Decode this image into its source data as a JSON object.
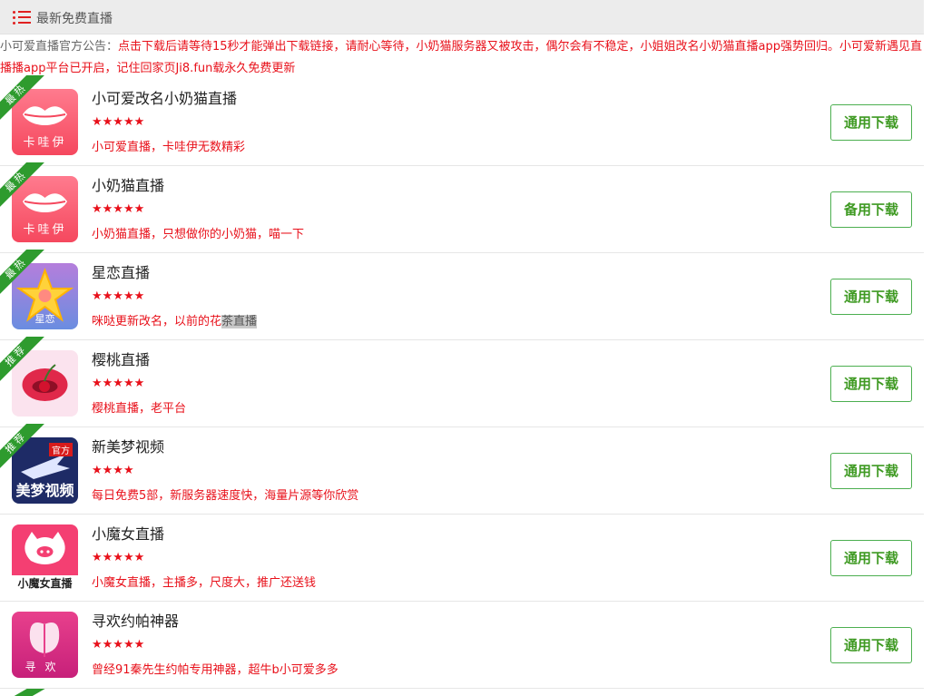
{
  "header": {
    "title": "最新免费直播",
    "icon": "list-icon"
  },
  "notice": {
    "prefix": "小可爱直播官方公告：",
    "text": "点击下载后请等待15秒才能弹出下载链接，请耐心等待，小奶猫服务器又被攻击，偶尔会有不稳定，小姐姐改名小奶猫直播app强势回归。小可爱新遇见直播播app平台已开启，记住回家页Ji8.fun载永久免费更新"
  },
  "items": [
    {
      "name": "小可爱改名小奶猫直播",
      "stars": "★★★★★",
      "desc": "小可爱直播，卡哇伊无数精彩",
      "button": "通用下载",
      "ribbon": "最热",
      "icon": "lips-icon",
      "icon_caption": "卡哇伊"
    },
    {
      "name": "小奶猫直播",
      "stars": "★★★★★",
      "desc": "小奶猫直播，只想做你的小奶猫，喵一下",
      "button": "备用下载",
      "ribbon": "最热",
      "icon": "lips-icon",
      "icon_caption": "卡哇伊"
    },
    {
      "name": "星恋直播",
      "stars": "★★★★★",
      "desc_a": "咪哒更新改名，以前的花",
      "desc_b": "茶直播",
      "button": "通用下载",
      "ribbon": "最热",
      "icon": "star-icon",
      "icon_caption": "星恋"
    },
    {
      "name": "樱桃直播",
      "stars": "★★★★★",
      "desc": "樱桃直播，老平台",
      "button": "通用下载",
      "ribbon": "推荐",
      "icon": "cherry-icon"
    },
    {
      "name": "新美梦视频",
      "stars": "★★★★",
      "desc": "每日免费5部，新服务器速度快，海量片源等你欣赏",
      "button": "通用下载",
      "ribbon": "推荐",
      "icon": "airplane-icon",
      "icon_caption": "美梦视频",
      "icon_tag": "官方"
    },
    {
      "name": "小魔女直播",
      "stars": "★★★★★",
      "desc": "小魔女直播，主播多，尺度大，推广还送钱",
      "button": "通用下载",
      "icon": "cat-face-icon",
      "icon_caption": "小魔女直播"
    },
    {
      "name": "寻欢约帕神器",
      "stars": "★★★★★",
      "desc": "曾经91秦先生约帕专用神器，超牛b小可爱多多",
      "button": "通用下载",
      "icon": "butterfly-icon",
      "icon_caption": "寻欢"
    }
  ],
  "colors": {
    "accent_red": "#e8101a",
    "button_green": "#3f9a23",
    "ribbon_green": "#2e9b2e",
    "header_bg": "#ececec"
  }
}
